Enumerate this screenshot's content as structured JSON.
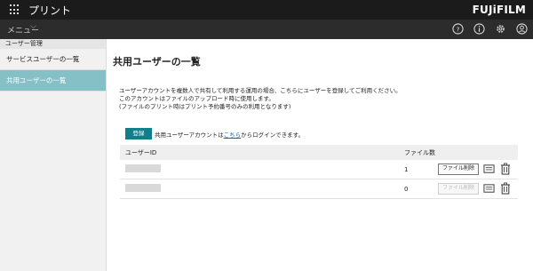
{
  "app": {
    "title": "プリント",
    "brand": "FUJiFILM"
  },
  "menubar": {
    "menu_label": "メニュー"
  },
  "top_icons": [
    "help-icon",
    "info-icon",
    "settings-icon",
    "user-icon"
  ],
  "sidebar": {
    "group_label": "ユーザー管理",
    "items": [
      {
        "label": "サービスユーザーの一覧",
        "active": false
      },
      {
        "label": "共用ユーザーの一覧",
        "active": true
      }
    ]
  },
  "main": {
    "title": "共用ユーザーの一覧",
    "description": [
      "ユーザーアカウントを複数人で共有して利用する運用の場合、こちらにユーザーを登録してご利用ください。",
      "このアカウントはファイルのアップロード時に使用します。",
      "(ファイルのプリント時はプリント予約番号のみの利用となります)"
    ],
    "register_label": "登録",
    "note_before": "共用ユーザーアカウントは",
    "note_link": "こちら",
    "note_after": "からログインできます。"
  },
  "table": {
    "headers": {
      "user_id": "ユーザーID",
      "file_count": "ファイル数"
    },
    "rows": [
      {
        "file_count": "1",
        "delete_label": "ファイル削除",
        "delete_enabled": true
      },
      {
        "file_count": "0",
        "delete_label": "ファイル削除",
        "delete_enabled": false
      }
    ]
  }
}
